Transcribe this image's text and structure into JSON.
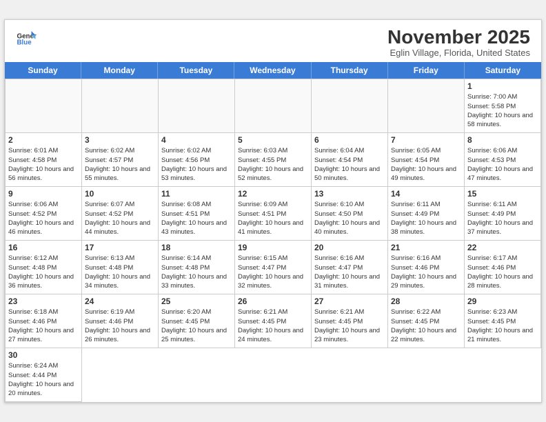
{
  "header": {
    "logo_general": "General",
    "logo_blue": "Blue",
    "title": "November 2025",
    "subtitle": "Eglin Village, Florida, United States"
  },
  "days": [
    "Sunday",
    "Monday",
    "Tuesday",
    "Wednesday",
    "Thursday",
    "Friday",
    "Saturday"
  ],
  "cells": [
    {
      "day": null,
      "empty": true
    },
    {
      "day": null,
      "empty": true
    },
    {
      "day": null,
      "empty": true
    },
    {
      "day": null,
      "empty": true
    },
    {
      "day": null,
      "empty": true
    },
    {
      "day": null,
      "empty": true
    },
    {
      "day": "1",
      "sunrise": "7:00 AM",
      "sunset": "5:58 PM",
      "daylight": "10 hours and 58 minutes."
    },
    {
      "day": "2",
      "sunrise": "6:01 AM",
      "sunset": "4:58 PM",
      "daylight": "10 hours and 56 minutes."
    },
    {
      "day": "3",
      "sunrise": "6:02 AM",
      "sunset": "4:57 PM",
      "daylight": "10 hours and 55 minutes."
    },
    {
      "day": "4",
      "sunrise": "6:02 AM",
      "sunset": "4:56 PM",
      "daylight": "10 hours and 53 minutes."
    },
    {
      "day": "5",
      "sunrise": "6:03 AM",
      "sunset": "4:55 PM",
      "daylight": "10 hours and 52 minutes."
    },
    {
      "day": "6",
      "sunrise": "6:04 AM",
      "sunset": "4:54 PM",
      "daylight": "10 hours and 50 minutes."
    },
    {
      "day": "7",
      "sunrise": "6:05 AM",
      "sunset": "4:54 PM",
      "daylight": "10 hours and 49 minutes."
    },
    {
      "day": "8",
      "sunrise": "6:06 AM",
      "sunset": "4:53 PM",
      "daylight": "10 hours and 47 minutes."
    },
    {
      "day": "9",
      "sunrise": "6:06 AM",
      "sunset": "4:52 PM",
      "daylight": "10 hours and 46 minutes."
    },
    {
      "day": "10",
      "sunrise": "6:07 AM",
      "sunset": "4:52 PM",
      "daylight": "10 hours and 44 minutes."
    },
    {
      "day": "11",
      "sunrise": "6:08 AM",
      "sunset": "4:51 PM",
      "daylight": "10 hours and 43 minutes."
    },
    {
      "day": "12",
      "sunrise": "6:09 AM",
      "sunset": "4:51 PM",
      "daylight": "10 hours and 41 minutes."
    },
    {
      "day": "13",
      "sunrise": "6:10 AM",
      "sunset": "4:50 PM",
      "daylight": "10 hours and 40 minutes."
    },
    {
      "day": "14",
      "sunrise": "6:11 AM",
      "sunset": "4:49 PM",
      "daylight": "10 hours and 38 minutes."
    },
    {
      "day": "15",
      "sunrise": "6:11 AM",
      "sunset": "4:49 PM",
      "daylight": "10 hours and 37 minutes."
    },
    {
      "day": "16",
      "sunrise": "6:12 AM",
      "sunset": "4:48 PM",
      "daylight": "10 hours and 36 minutes."
    },
    {
      "day": "17",
      "sunrise": "6:13 AM",
      "sunset": "4:48 PM",
      "daylight": "10 hours and 34 minutes."
    },
    {
      "day": "18",
      "sunrise": "6:14 AM",
      "sunset": "4:48 PM",
      "daylight": "10 hours and 33 minutes."
    },
    {
      "day": "19",
      "sunrise": "6:15 AM",
      "sunset": "4:47 PM",
      "daylight": "10 hours and 32 minutes."
    },
    {
      "day": "20",
      "sunrise": "6:16 AM",
      "sunset": "4:47 PM",
      "daylight": "10 hours and 31 minutes."
    },
    {
      "day": "21",
      "sunrise": "6:16 AM",
      "sunset": "4:46 PM",
      "daylight": "10 hours and 29 minutes."
    },
    {
      "day": "22",
      "sunrise": "6:17 AM",
      "sunset": "4:46 PM",
      "daylight": "10 hours and 28 minutes."
    },
    {
      "day": "23",
      "sunrise": "6:18 AM",
      "sunset": "4:46 PM",
      "daylight": "10 hours and 27 minutes."
    },
    {
      "day": "24",
      "sunrise": "6:19 AM",
      "sunset": "4:46 PM",
      "daylight": "10 hours and 26 minutes."
    },
    {
      "day": "25",
      "sunrise": "6:20 AM",
      "sunset": "4:45 PM",
      "daylight": "10 hours and 25 minutes."
    },
    {
      "day": "26",
      "sunrise": "6:21 AM",
      "sunset": "4:45 PM",
      "daylight": "10 hours and 24 minutes."
    },
    {
      "day": "27",
      "sunrise": "6:21 AM",
      "sunset": "4:45 PM",
      "daylight": "10 hours and 23 minutes."
    },
    {
      "day": "28",
      "sunrise": "6:22 AM",
      "sunset": "4:45 PM",
      "daylight": "10 hours and 22 minutes."
    },
    {
      "day": "29",
      "sunrise": "6:23 AM",
      "sunset": "4:45 PM",
      "daylight": "10 hours and 21 minutes."
    },
    {
      "day": "30",
      "sunrise": "6:24 AM",
      "sunset": "4:44 PM",
      "daylight": "10 hours and 20 minutes."
    }
  ]
}
